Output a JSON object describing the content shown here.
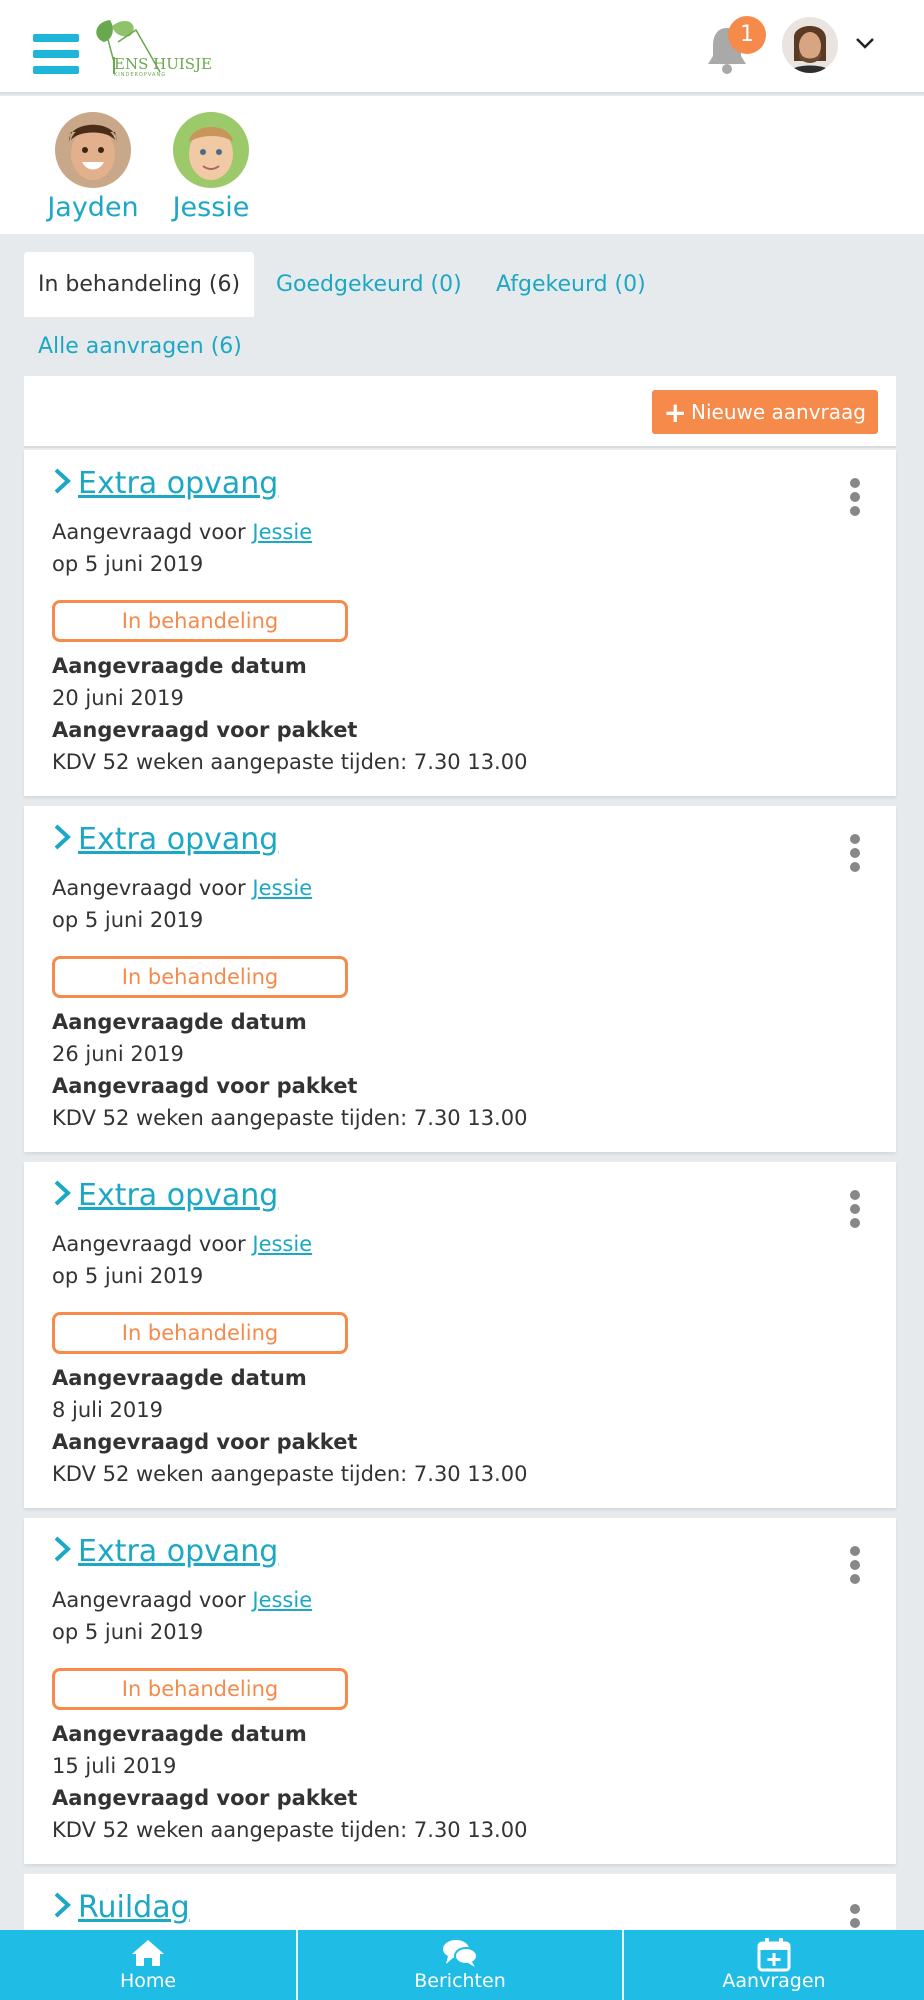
{
  "header": {
    "logo_text": "ENS HUISJE",
    "logo_subtext": "KINDEROPVANG",
    "notification_count": "1"
  },
  "children": [
    {
      "name": "Jayden"
    },
    {
      "name": "Jessie"
    }
  ],
  "tabs": [
    {
      "label": "In behandeling (6)",
      "active": true
    },
    {
      "label": "Goedgekeurd (0)",
      "active": false
    },
    {
      "label": "Afgekeurd (0)",
      "active": false
    },
    {
      "label": "Alle aanvragen (6)",
      "active": false
    }
  ],
  "toolbar": {
    "new_request_label": "Nieuwe aanvraag"
  },
  "requests": [
    {
      "title": "Extra opvang",
      "requested_for_prefix": "Aangevraagd voor ",
      "child": "Jessie",
      "date_line": "op 5 juni 2019",
      "status": "In behandeling",
      "date_label": "Aangevraagde datum",
      "date_value": "20 juni 2019",
      "package_label": "Aangevraagd voor pakket",
      "package_value": "KDV 52 weken aangepaste tijden: 7.30 13.00"
    },
    {
      "title": "Extra opvang",
      "requested_for_prefix": "Aangevraagd voor ",
      "child": "Jessie",
      "date_line": "op 5 juni 2019",
      "status": "In behandeling",
      "date_label": "Aangevraagde datum",
      "date_value": "26 juni 2019",
      "package_label": "Aangevraagd voor pakket",
      "package_value": "KDV 52 weken aangepaste tijden: 7.30 13.00"
    },
    {
      "title": "Extra opvang",
      "requested_for_prefix": "Aangevraagd voor ",
      "child": "Jessie",
      "date_line": "op 5 juni 2019",
      "status": "In behandeling",
      "date_label": "Aangevraagde datum",
      "date_value": "8 juli 2019",
      "package_label": "Aangevraagd voor pakket",
      "package_value": "KDV 52 weken aangepaste tijden: 7.30 13.00"
    },
    {
      "title": "Extra opvang",
      "requested_for_prefix": "Aangevraagd voor ",
      "child": "Jessie",
      "date_line": "op 5 juni 2019",
      "status": "In behandeling",
      "date_label": "Aangevraagde datum",
      "date_value": "15 juli 2019",
      "package_label": "Aangevraagd voor pakket",
      "package_value": "KDV 52 weken aangepaste tijden: 7.30 13.00"
    },
    {
      "title": "Ruildag"
    }
  ],
  "bottom_nav": [
    {
      "label": "Home",
      "icon": "home-icon"
    },
    {
      "label": "Berichten",
      "icon": "chat-icon"
    },
    {
      "label": "Aanvragen",
      "icon": "calendar-plus-icon"
    }
  ],
  "colors": {
    "accent": "#1ca8c4",
    "nav_bg": "#1fbde6",
    "orange": "#f58a4b",
    "page_bg": "#e6eaed"
  }
}
